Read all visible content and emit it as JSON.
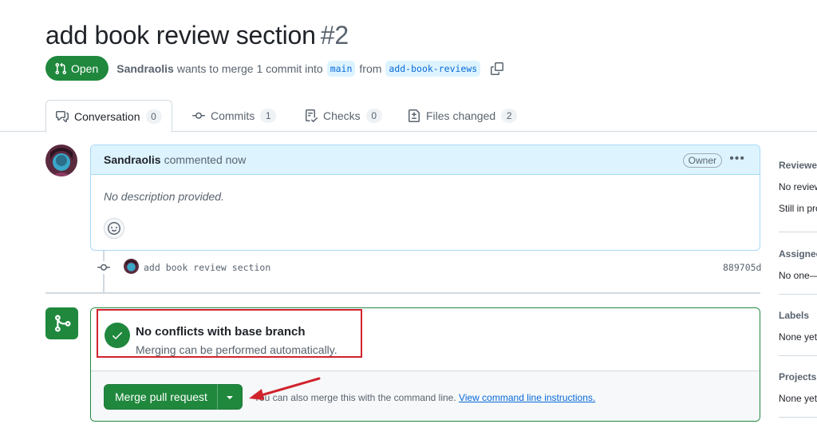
{
  "pr": {
    "title": "add book review section",
    "number": "#2",
    "state": "Open",
    "author": "Sandraolis",
    "summary": "wants to merge 1 commit into",
    "base_branch": "main",
    "from_text": "from",
    "head_branch": "add-book-reviews"
  },
  "tabs": [
    {
      "label": "Conversation",
      "count": "0",
      "icon": "comment-discussion-icon"
    },
    {
      "label": "Commits",
      "count": "1",
      "icon": "git-commit-icon"
    },
    {
      "label": "Checks",
      "count": "0",
      "icon": "checklist-icon"
    },
    {
      "label": "Files changed",
      "count": "2",
      "icon": "file-diff-icon"
    }
  ],
  "comment": {
    "author": "Sandraolis",
    "action": "commented now",
    "role_badge": "Owner",
    "body": "No description provided."
  },
  "commit": {
    "message": "add book review section",
    "sha": "889705d"
  },
  "merge": {
    "status_title": "No conflicts with base branch",
    "status_sub": "Merging can be performed automatically.",
    "button_label": "Merge pull request",
    "cli_text": "You can also merge this with the command line.",
    "cli_link": "View command line instructions."
  },
  "sidebar": {
    "reviewers": {
      "title": "Reviewers",
      "line1": "No reviews",
      "line2": "Still in progress"
    },
    "assignees": {
      "title": "Assignees",
      "line1": "No one—"
    },
    "labels": {
      "title": "Labels",
      "line1": "None yet"
    },
    "projects": {
      "title": "Projects",
      "line1": "None yet"
    }
  },
  "colors": {
    "success": "#1f883d",
    "accent": "#0969da",
    "annotation": "#d0232c"
  }
}
